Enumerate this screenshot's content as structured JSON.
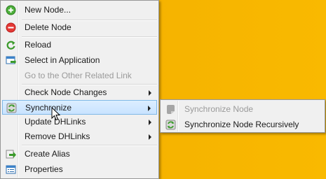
{
  "colors": {
    "desktop": "#f7b500",
    "menu_bg": "#f0f0f0",
    "highlight": "#c9e3ff",
    "disabled_text": "#9a9a9a"
  },
  "main_menu": {
    "items": [
      {
        "label": "New Node...",
        "icon": "add-node-icon"
      },
      {
        "label": "Delete Node",
        "icon": "delete-node-icon"
      },
      {
        "label": "Reload",
        "icon": "reload-icon"
      },
      {
        "label": "Select in Application",
        "icon": "select-in-application-icon"
      },
      {
        "label": "Go to the Other Related Link",
        "disabled": true
      },
      {
        "label": "Check Node Changes",
        "submenu": true
      },
      {
        "label": "Synchronize",
        "icon": "synchronize-icon",
        "submenu": true,
        "highlighted": true
      },
      {
        "label": "Update DHLinks",
        "submenu": true
      },
      {
        "label": "Remove DHLinks",
        "submenu": true
      },
      {
        "label": "Create Alias",
        "icon": "create-alias-icon"
      },
      {
        "label": "Properties",
        "icon": "properties-icon"
      }
    ]
  },
  "sub_menu": {
    "items": [
      {
        "label": "Synchronize Node",
        "icon": "synchronize-node-icon",
        "disabled": true
      },
      {
        "label": "Synchronize Node Recursively",
        "icon": "synchronize-recursive-icon"
      }
    ]
  }
}
